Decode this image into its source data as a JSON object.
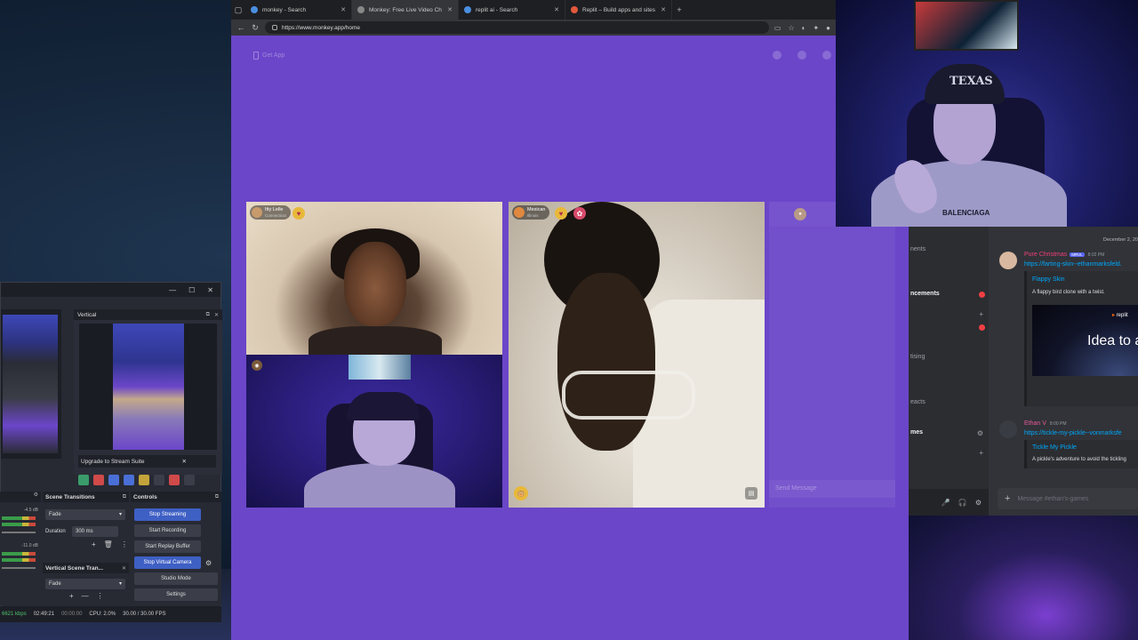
{
  "browser": {
    "tabs": [
      {
        "label": "monkey - Search",
        "active": false,
        "icon": "bing-icon"
      },
      {
        "label": "Monkey: Free Live Video Ch",
        "active": true,
        "icon": "monkey-icon"
      },
      {
        "label": "replit ai - Search",
        "active": false,
        "icon": "bing-icon"
      },
      {
        "label": "Replit – Build apps and sites with",
        "active": false,
        "icon": "replit-icon"
      }
    ],
    "url": "https://www.monkey.app/home"
  },
  "monkey": {
    "get_app": "Get App",
    "users": {
      "top_left": {
        "name": "Itty Lelle",
        "location": "Connecticut"
      },
      "right": {
        "name": "Mexican",
        "location": "Illinois"
      }
    },
    "send_message_placeholder": "Send Message"
  },
  "webcam": {
    "cap_text": "TEXAS",
    "shirt_text": "BALENCIAGA"
  },
  "discord": {
    "channels": [
      {
        "label": "nents",
        "bold": false
      },
      {
        "label": "ncements",
        "bold": true
      },
      {
        "label": "tising",
        "bold": false
      },
      {
        "label": "eacts",
        "bold": false
      },
      {
        "label": "mes",
        "bold": true
      }
    ],
    "date": "December 2, 20",
    "messages": [
      {
        "author": "Pure Christmas",
        "tag": "MRVL",
        "time": "8:02 PM",
        "link": "https://farting-skin--ethanmarksfeld.",
        "embed_title": "Flappy Skin",
        "embed_desc": "A flappy bird clone with a twist.",
        "embed_image_logo": "replit",
        "embed_image_text": "Idea to app"
      },
      {
        "author": "Ethan V",
        "time": "8:00 PM",
        "link": "https://tickle-my-pickle--vonmarksfe",
        "embed_title": "Tickle My Pickle",
        "embed_desc": "A pickle's adventure to avoid the tickling"
      }
    ],
    "input_placeholder": "Message #ethan's-games"
  },
  "obs": {
    "vertical_title": "Vertical",
    "upgrade_label": "Upgrade to Stream Suite",
    "mixer": {
      "db1": "-4.5 dB",
      "db2": "-11.0 dB"
    },
    "scene_transitions": {
      "title": "Scene Transitions",
      "transition": "Fade",
      "duration_label": "Duration",
      "duration_value": "300 ms"
    },
    "vertical_scene_transitions": {
      "title": "Vertical Scene Tran...",
      "transition": "Fade"
    },
    "controls": {
      "title": "Controls",
      "buttons": [
        "Stop Streaming",
        "Start Recording",
        "Start Replay Buffer",
        "Stop Virtual Camera",
        "Studio Mode",
        "Settings"
      ]
    },
    "status": {
      "bitrate": "6621 kbps",
      "live_time": "02:49:21",
      "rec_time": "00:00:00",
      "cpu": "CPU: 2.0%",
      "fps": "30.00 / 30.00 FPS"
    }
  },
  "colors": {
    "monkey_bg": "#6b46c9",
    "discord_bg": "#313338",
    "obs_bg": "#272a33",
    "obs_accent": "#3e5fc4"
  }
}
